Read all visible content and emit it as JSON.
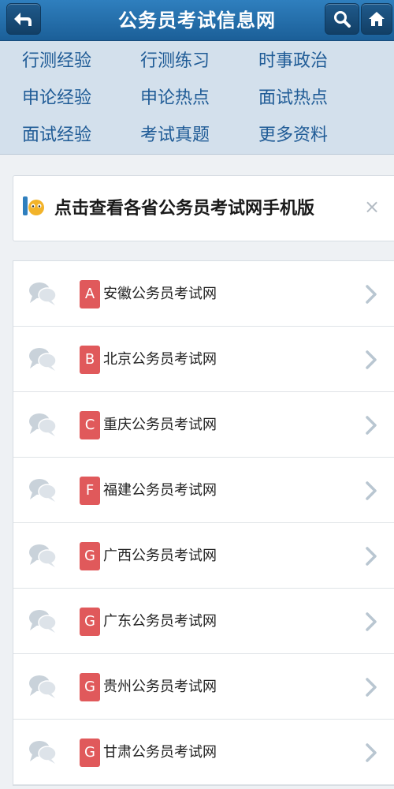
{
  "header": {
    "title": "公务员考试信息网",
    "back_icon": "back-arrow-icon",
    "search_icon": "search-icon",
    "home_icon": "home-icon"
  },
  "categories": [
    "行测经验",
    "行测练习",
    "时事政治",
    "申论经验",
    "申论热点",
    "面试热点",
    "面试经验",
    "考试真题",
    "更多资料"
  ],
  "notice": {
    "text": "点击查看各省公务员考试网手机版",
    "close_glyph": "×",
    "logo_icon": "site-logo-icon"
  },
  "provinces": [
    {
      "letter": "A",
      "name": "安徽公务员考试网"
    },
    {
      "letter": "B",
      "name": "北京公务员考试网"
    },
    {
      "letter": "C",
      "name": "重庆公务员考试网"
    },
    {
      "letter": "F",
      "name": "福建公务员考试网"
    },
    {
      "letter": "G",
      "name": "广西公务员考试网"
    },
    {
      "letter": "G",
      "name": "广东公务员考试网"
    },
    {
      "letter": "G",
      "name": "贵州公务员考试网"
    },
    {
      "letter": "G",
      "name": "甘肃公务员考试网"
    }
  ],
  "colors": {
    "header_blue": "#1b5f98",
    "nav_text": "#1f5b96",
    "letter_badge": "#e0595b"
  }
}
